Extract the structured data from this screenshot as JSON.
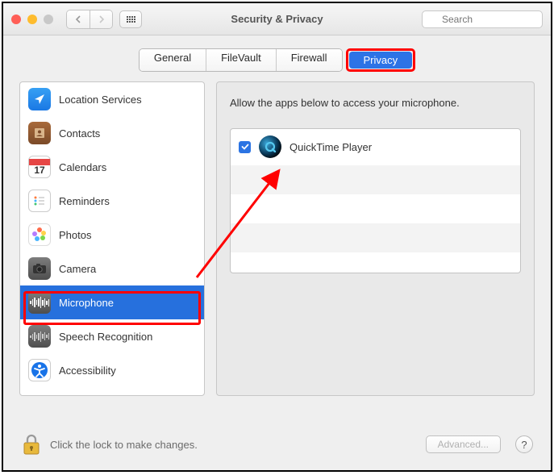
{
  "window": {
    "title": "Security & Privacy",
    "search_placeholder": "Search"
  },
  "tabs": {
    "general": "General",
    "filevault": "FileVault",
    "firewall": "Firewall",
    "privacy": "Privacy"
  },
  "sidebar": {
    "location": "Location Services",
    "contacts": "Contacts",
    "calendars": "Calendars",
    "calendar_day": "17",
    "reminders": "Reminders",
    "photos": "Photos",
    "camera": "Camera",
    "microphone": "Microphone",
    "speech": "Speech Recognition",
    "accessibility": "Accessibility"
  },
  "right": {
    "description": "Allow the apps below to access your microphone.",
    "apps": [
      {
        "name": "QuickTime Player",
        "checked": true
      }
    ]
  },
  "footer": {
    "lock_text": "Click the lock to make changes.",
    "advanced": "Advanced...",
    "help": "?"
  }
}
